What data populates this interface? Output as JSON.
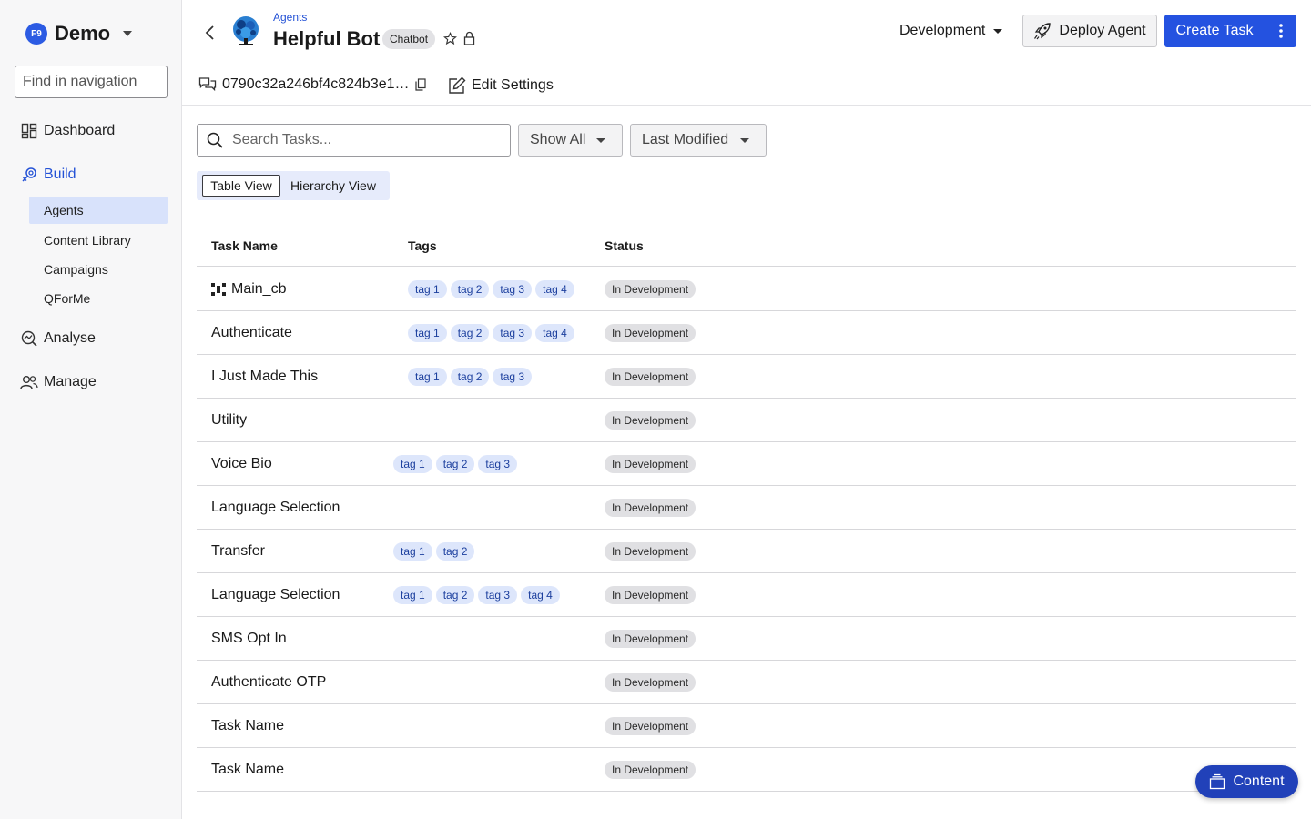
{
  "sidebar": {
    "org_badge": "F9",
    "org_name": "Demo",
    "search_placeholder": "Find in navigation",
    "nav": {
      "dashboard": "Dashboard",
      "build": "Build",
      "analyse": "Analyse",
      "manage": "Manage"
    },
    "build_items": [
      "Agents",
      "Content Library",
      "Campaigns",
      "QForMe"
    ]
  },
  "header": {
    "breadcrumb": "Agents",
    "title": "Helpful Bot",
    "type_chip": "Chatbot",
    "agent_id": "0790c32a246bf4c824b3e1…",
    "edit_settings": "Edit Settings",
    "environment": "Development",
    "deploy_label": "Deploy Agent",
    "create_label": "Create Task"
  },
  "filters": {
    "search_placeholder": "Search Tasks...",
    "show_filter": "Show All",
    "sort_filter": "Last Modified",
    "views": [
      "Table View",
      "Hierarchy View"
    ]
  },
  "table": {
    "columns": [
      "Task Name",
      "Tags",
      "Status"
    ],
    "rows": [
      {
        "name": "Main_cb",
        "tags": [
          "tag 1",
          "tag 2",
          "tag 3",
          "tag 4"
        ],
        "status": "In Development"
      },
      {
        "name": "Authenticate",
        "tags": [
          "tag 1",
          "tag 2",
          "tag 3",
          "tag 4"
        ],
        "status": "In Development"
      },
      {
        "name": "I Just Made This",
        "tags": [
          "tag 1",
          "tag 2",
          "tag 3"
        ],
        "status": "In Development"
      },
      {
        "name": "Utility",
        "tags": [],
        "status": "In Development"
      },
      {
        "name": "Voice Bio",
        "tags": [
          "tag 1",
          "tag 2",
          "tag 3"
        ],
        "status": "In Development"
      },
      {
        "name": "Language Selection",
        "tags": [],
        "status": "In Development"
      },
      {
        "name": "Transfer",
        "tags": [
          "tag 1",
          "tag 2"
        ],
        "status": "In Development"
      },
      {
        "name": "Language Selection",
        "tags": [
          "tag 1",
          "tag 2",
          "tag 3",
          "tag 4"
        ],
        "status": "In Development"
      },
      {
        "name": "SMS Opt In",
        "tags": [],
        "status": "In Development"
      },
      {
        "name": "Authenticate OTP",
        "tags": [],
        "status": "In Development"
      },
      {
        "name": "Task Name",
        "tags": [],
        "status": "In Development"
      },
      {
        "name": "Task Name",
        "tags": [],
        "status": "In Development"
      }
    ]
  },
  "fab": {
    "label": "Content"
  },
  "colors": {
    "accent": "#2452e0",
    "tag_bg": "#dde6fb",
    "tag_text": "#1c3f9e",
    "status_bg": "#e0e0e3",
    "sidebar_selected": "#d8e2fb"
  }
}
